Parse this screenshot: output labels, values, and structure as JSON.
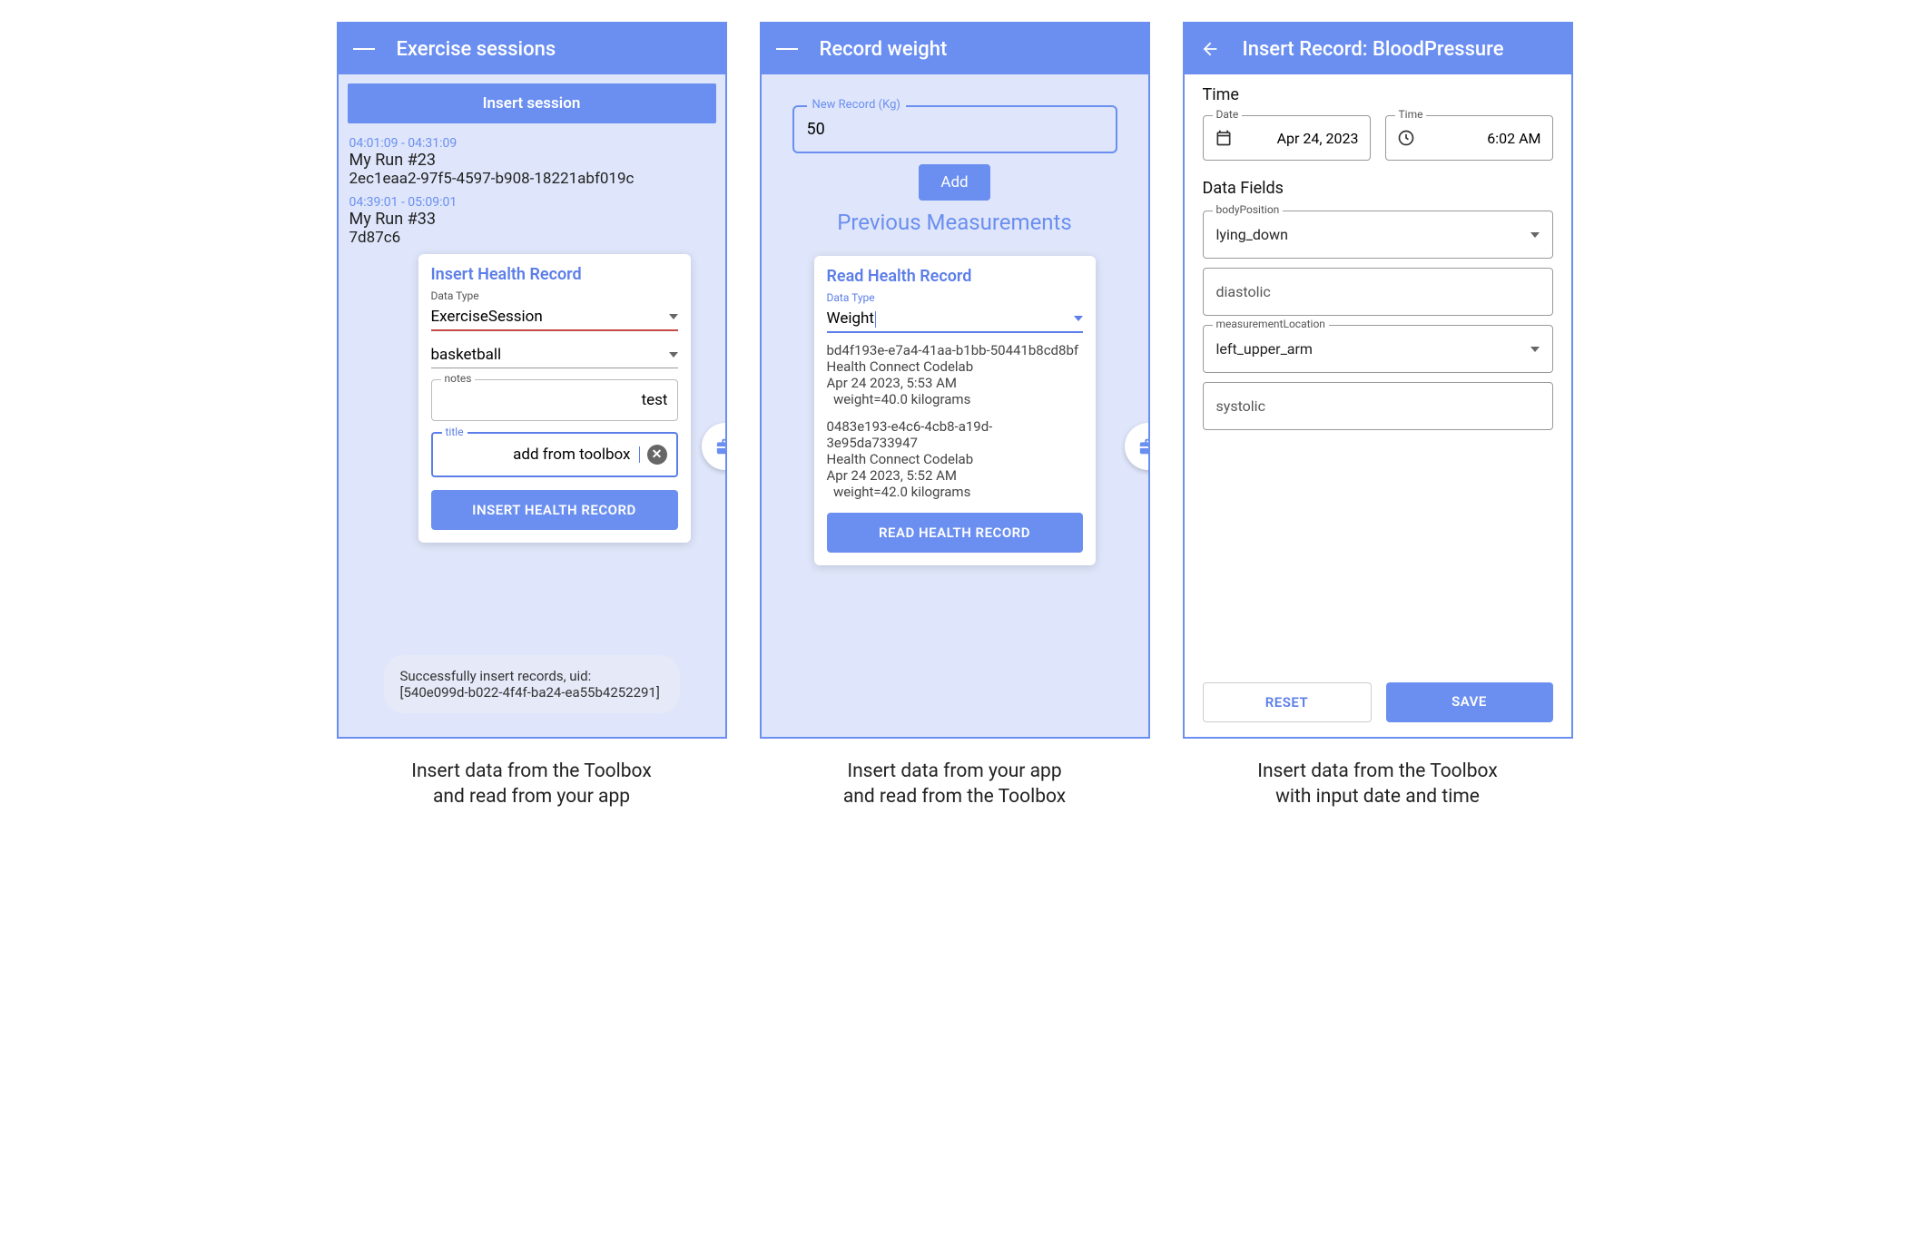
{
  "screen1": {
    "appbar_title": "Exercise sessions",
    "insert_session_btn": "Insert session",
    "sessions": [
      {
        "time": "04:01:09 - 04:31:09",
        "name": "My Run #23",
        "uid": "2ec1eaa2-97f5-4597-b908-18221abf019c"
      },
      {
        "time": "04:39:01 - 05:09:01",
        "name": "My Run #33",
        "uid": "7d87c6"
      }
    ],
    "popover": {
      "title": "Insert Health Record",
      "datatype_label": "Data Type",
      "datatype_value": "ExerciseSession",
      "exercise_value": "basketball",
      "notes_label": "notes",
      "notes_value": "test",
      "title_label": "title",
      "title_value": "add from toolbox",
      "button": "INSERT HEALTH RECORD"
    },
    "snackbar_line1": "Successfully insert records, uid:",
    "snackbar_line2": "[540e099d-b022-4f4f-ba24-ea55b4252291]",
    "caption_line1": "Insert data from the Toolbox",
    "caption_line2": "and read from your app"
  },
  "screen2": {
    "appbar_title": "Record weight",
    "new_record_label": "New Record (Kg)",
    "new_record_value": "50",
    "add_btn": "Add",
    "prev_title": "Previous Measurements",
    "popover": {
      "title": "Read Health Record",
      "datatype_label": "Data Type",
      "datatype_value": "Weight",
      "records": [
        {
          "id": "bd4f193e-e7a4-41aa-b1bb-50441b8cd8bf",
          "app": "Health Connect Codelab",
          "ts": "Apr 24 2023, 5:53 AM",
          "val": "  weight=40.0 kilograms"
        },
        {
          "id": "0483e193-e4c6-4cb8-a19d-3e95da733947",
          "app": "Health Connect Codelab",
          "ts": "Apr 24 2023, 5:52 AM",
          "val": "  weight=42.0 kilograms"
        }
      ],
      "button": "READ HEALTH RECORD"
    },
    "caption_line1": "Insert data from your app",
    "caption_line2": "and read from the Toolbox"
  },
  "screen3": {
    "appbar_title": "Insert Record: BloodPressure",
    "time_section": "Time",
    "date_label": "Date",
    "date_value": "Apr 24, 2023",
    "time_label": "Time",
    "time_value": "6:02 AM",
    "datafields_section": "Data Fields",
    "body_pos_label": "bodyPosition",
    "body_pos_value": "lying_down",
    "diastolic": "diastolic",
    "meas_loc_label": "measurementLocation",
    "meas_loc_value": "left_upper_arm",
    "systolic": "systolic",
    "reset_btn": "RESET",
    "save_btn": "SAVE",
    "caption_line1": "Insert data from the Toolbox",
    "caption_line2": "with input date and time"
  }
}
